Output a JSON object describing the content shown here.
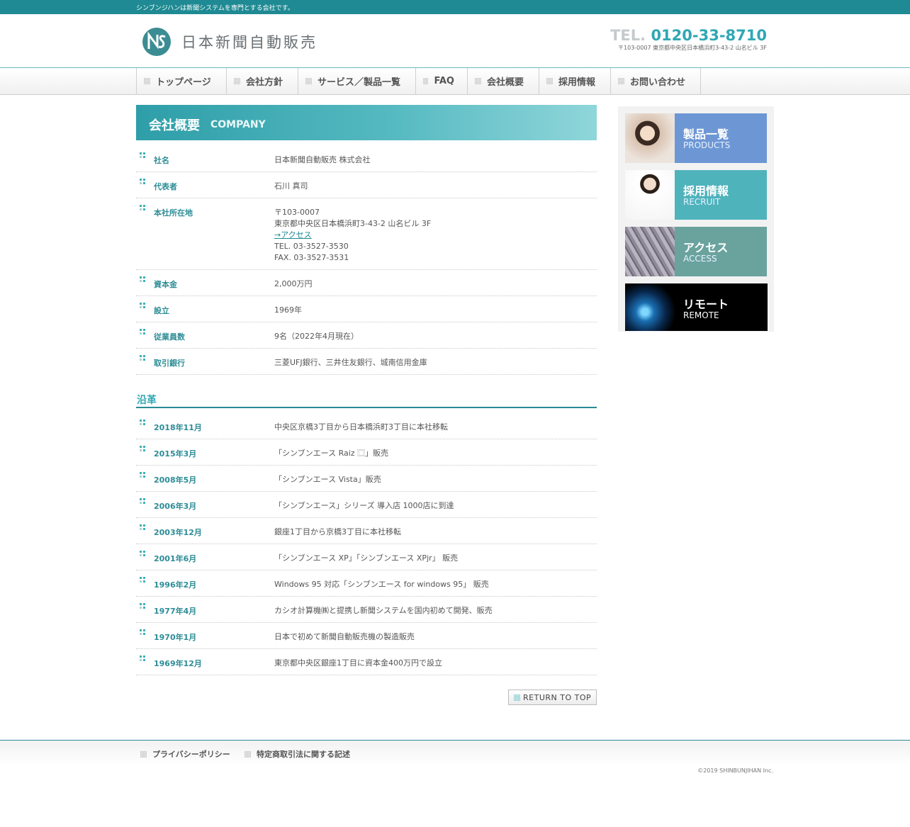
{
  "topbar": {
    "tagline": "シンブンジハンは新聞システムを専門とする会社です。"
  },
  "header": {
    "logo_text": "日本新聞自動販売",
    "tel_label": "TEL.",
    "tel_number": "0120-33-8710",
    "address": "〒103-0007 東京都中央区日本橋浜町3-43-2 山名ビル 3F",
    "accent_color": "#1f8a93"
  },
  "nav": {
    "items": [
      {
        "label": "トップページ"
      },
      {
        "label": "会社方針"
      },
      {
        "label": "サービス／製品一覧"
      },
      {
        "label": "FAQ"
      },
      {
        "label": "会社概要"
      },
      {
        "label": "採用情報"
      },
      {
        "label": "お問い合わせ"
      }
    ]
  },
  "page": {
    "title_jp": "会社概要",
    "title_en": "COMPANY"
  },
  "company": {
    "name_label": "社名",
    "name": "日本新聞自動販売 株式会社",
    "rep_label": "代表者",
    "rep": "石川 真司",
    "office_label": "本社所在地",
    "postal": "〒103-0007",
    "address": "東京都中央区日本橋浜町3-43-2 山名ビル 3F",
    "access_link": "→アクセス",
    "tel": "TEL. 03-3527-3530",
    "fax": "FAX. 03-3527-3531",
    "capital_label": "資本金",
    "capital": "2,000万円",
    "founded_label": "設立",
    "founded": "1969年",
    "employees_label": "従業員数",
    "employees": "9名（2022年4月現在）",
    "bank_label": "取引銀行",
    "bank": "三菱UFJ銀行、三井住友銀行、城南信用金庫"
  },
  "history": {
    "heading": "沿革",
    "items": [
      {
        "date": "2018年11月",
        "text": "中央区京橋3丁目から日本橋浜町3丁目に本社移転"
      },
      {
        "date": "2015年3月",
        "text": "「シンブンエース Raiz ⿴」販売"
      },
      {
        "date": "2008年5月",
        "text": "「シンブンエース Vista」販売"
      },
      {
        "date": "2006年3月",
        "text": "「シンブンエース」シリーズ 導入店 1000店に到達"
      },
      {
        "date": "2003年12月",
        "text": "銀座1丁目から京橋3丁目に本社移転"
      },
      {
        "date": "2001年6月",
        "text": "「シンブンエース XP」「シンブンエース XPjr」 販売"
      },
      {
        "date": "1996年2月",
        "text": "Windows 95 対応「シンブンエース for windows 95」 販売"
      },
      {
        "date": "1977年4月",
        "text": "カシオ計算機㈱と提携し新聞システムを国内初めて開発、販売"
      },
      {
        "date": "1970年1月",
        "text": "日本で初めて新聞自動販売機の製造販売"
      },
      {
        "date": "1969年12月",
        "text": "東京都中央区銀座1丁目に資本金400万円で設立"
      }
    ]
  },
  "return_to_top": "RETURN TO TOP",
  "sidebar": {
    "banners": [
      {
        "jp": "製品一覧",
        "en": "PRODUCTS",
        "color": "#6d97d4"
      },
      {
        "jp": "採用情報",
        "en": "RECRUIT",
        "color": "#4fb3bc"
      },
      {
        "jp": "アクセス",
        "en": "ACCESS",
        "color": "#6aa39e"
      },
      {
        "jp": "リモート",
        "en": "REMOTE",
        "color": "#000000"
      }
    ]
  },
  "footer": {
    "links": [
      {
        "label": "プライバシーポリシー"
      },
      {
        "label": "特定商取引法に関する記述"
      }
    ],
    "copyright": "©2019 SHINBUNJIHAN Inc."
  }
}
